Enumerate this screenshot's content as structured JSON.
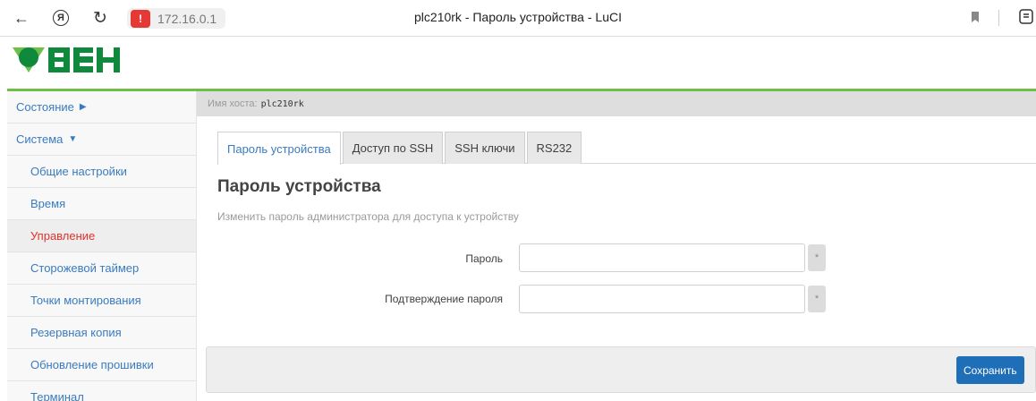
{
  "browser": {
    "address": "172.16.0.1",
    "page_title": "plc210rk - Пароль устройства - LuCI",
    "ya_letter": "Я"
  },
  "logo": {
    "text": "ОВЕН",
    "brand_color": "#0f8a3c"
  },
  "host": {
    "label": "Имя хоста:",
    "value": "plc210rk"
  },
  "sidebar": {
    "items": [
      {
        "label": "Состояние",
        "kind": "top",
        "indicator": "▶"
      },
      {
        "label": "Система",
        "kind": "top",
        "indicator": "▼"
      },
      {
        "label": "Общие настройки",
        "kind": "sub"
      },
      {
        "label": "Время",
        "kind": "sub"
      },
      {
        "label": "Управление",
        "kind": "sub",
        "active": true
      },
      {
        "label": "Сторожевой таймер",
        "kind": "sub"
      },
      {
        "label": "Точки монтирования",
        "kind": "sub"
      },
      {
        "label": "Резервная копия",
        "kind": "sub"
      },
      {
        "label": "Обновление прошивки",
        "kind": "sub"
      },
      {
        "label": "Терминал",
        "kind": "sub"
      }
    ]
  },
  "tabs": [
    {
      "label": "Пароль устройства",
      "active": true
    },
    {
      "label": "Доступ по SSH"
    },
    {
      "label": "SSH ключи"
    },
    {
      "label": "RS232"
    }
  ],
  "section": {
    "title": "Пароль устройства",
    "description": "Изменить пароль администратора для доступа к устройству"
  },
  "form": {
    "password_label": "Пароль",
    "password_value": "",
    "confirm_label": "Подтверждение пароля",
    "confirm_value": "",
    "required_marker": "*"
  },
  "actions": {
    "save_label": "Сохранить"
  },
  "colors": {
    "accent": "#3a7bbf",
    "active": "#e0312b",
    "button": "#1f6fb8",
    "logo_green": "#6cc04a"
  }
}
